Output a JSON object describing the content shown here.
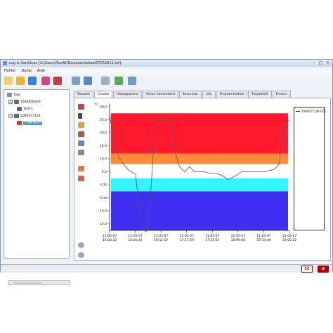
{
  "window": {
    "title": "Log-ic CertiScan [C:\\Users\\TomW\\Documents\\test07052011.txt]",
    "controls": [
      "–",
      "□",
      "×"
    ]
  },
  "menu": [
    "Fichier",
    "Outils",
    "Aide"
  ],
  "toolbar": {
    "icons": [
      "new-icon",
      "open-icon",
      "save-icon",
      "print-icon",
      "read-tag-icon",
      "search-icon",
      "zoom-icon",
      "edit-icon",
      "check-icon",
      "settings-icon"
    ]
  },
  "tree": {
    "root": "Tags",
    "nodes": [
      {
        "label": "2080006290",
        "expand": "⊟"
      },
      {
        "label": "TEST1"
      },
      {
        "label": "2080017128",
        "expand": "⊟"
      },
      {
        "label": "LT08.0424",
        "selected": true
      }
    ]
  },
  "tabs": [
    "Resumé",
    "Courbe",
    "Histogramme",
    "Vision Camembert",
    "Excursion",
    "Info",
    "Programmation",
    "Traçabilité",
    "Erreurs"
  ],
  "active_tab": "Courbe",
  "status": {
    "left_button": "2C",
    "right_button": "⊠"
  },
  "colors": {
    "band_red": "#ff1a2e",
    "band_orange": "#ff8a3a",
    "band_cyan": "#33f5ff",
    "band_blue": "#3f2ff0",
    "curve": "#555555"
  },
  "chart_data": {
    "type": "line",
    "ylabel": "°C",
    "ylim": [
      -17.5,
      30
    ],
    "yticks": [
      "30.0",
      "25.0",
      "20.0",
      "15.0",
      "10.0",
      "5.0",
      "0.00",
      "-5.00",
      "-10.0",
      "-15.0"
    ],
    "ytick_values": [
      30,
      25,
      20,
      15,
      10,
      5,
      0,
      -5,
      -10,
      -15
    ],
    "xticks": [
      [
        "11-05-07",
        "16:00:32"
      ],
      [
        "11-05-07",
        "16:26:14"
      ],
      [
        "11-05-07",
        "16:51:57"
      ],
      [
        "11-05-07",
        "17:17:40"
      ],
      [
        "11-05-07",
        "17:43:23"
      ],
      [
        "11-05-07",
        "18:09:06"
      ],
      [
        "11-05-07",
        "18:34:49"
      ],
      [
        "11-05-07",
        "19:00:32"
      ]
    ],
    "xlim": [
      0,
      180
    ],
    "bands": [
      {
        "from": 12,
        "to": 27.5,
        "color": "#ff1a2e"
      },
      {
        "from": 8,
        "to": 12,
        "color": "#ff8a3a"
      },
      {
        "from": 8,
        "to": 2.5,
        "color": "#ffffff"
      },
      {
        "from": -2.5,
        "to": 2.5,
        "color": "#33f5ff"
      },
      {
        "from": -17.5,
        "to": -2.5,
        "color": "#3f2ff0"
      }
    ],
    "legend": [
      "2080017128-UC1"
    ],
    "series": [
      {
        "name": "2080017128-UC1",
        "x": [
          0,
          3,
          6,
          10,
          14,
          18,
          22,
          26,
          28,
          31,
          34,
          36,
          38,
          40,
          45,
          50,
          55,
          60,
          62,
          66,
          70,
          75,
          80,
          85,
          90,
          95,
          100,
          105,
          110,
          115,
          118,
          121,
          124,
          128,
          132,
          136,
          140,
          145,
          150,
          155,
          160,
          165,
          170,
          172,
          174,
          176,
          178,
          180
        ],
        "y": [
          27,
          20,
          14,
          10,
          8,
          6,
          5,
          4,
          -3,
          -12,
          -17,
          -18,
          -17.5,
          -10,
          20,
          26,
          26,
          25,
          24,
          12,
          7,
          5,
          7,
          5,
          5,
          5,
          4.5,
          4.5,
          4,
          3,
          2,
          2.5,
          3,
          4,
          5,
          5,
          5,
          5,
          5,
          5,
          5.5,
          6,
          8,
          18,
          21,
          23,
          24,
          25
        ]
      }
    ]
  }
}
